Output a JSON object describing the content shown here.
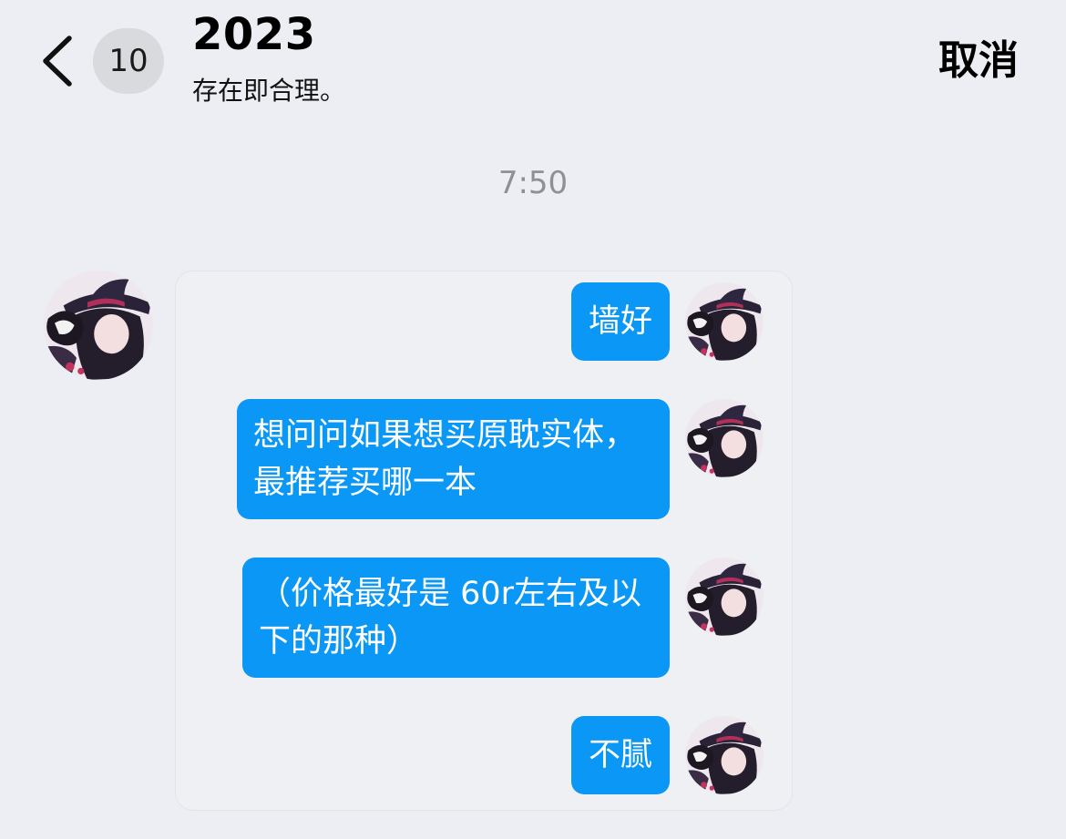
{
  "header": {
    "back_icon": "chevron-left-icon",
    "unread_count": "10",
    "title": "2023",
    "subtitle": "存在即合理。",
    "cancel_label": "取消"
  },
  "timestamp": "7:50",
  "forwarded_messages": [
    {
      "text": "墙好"
    },
    {
      "text": "想问问如果想买原耽实体，\n最推荐买哪一本"
    },
    {
      "text": "（价格最好是 60r左右及以\n下的那种）"
    },
    {
      "text": "不腻"
    }
  ],
  "colors": {
    "background": "#eceef3",
    "bubble": "#0a97f5",
    "badge": "#d9dade",
    "timestamp": "#8e9096"
  }
}
